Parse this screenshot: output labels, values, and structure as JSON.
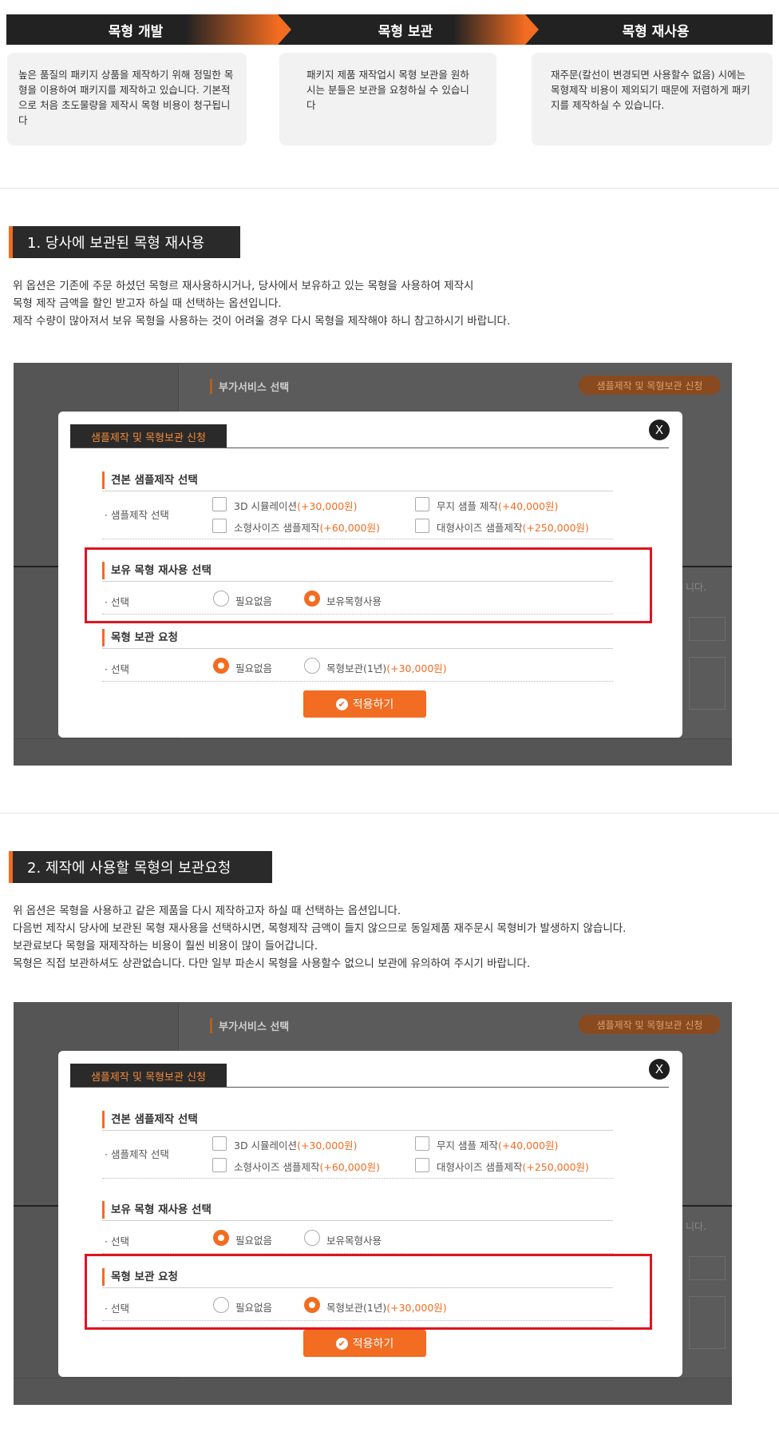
{
  "steps": [
    {
      "label": "목형 개발"
    },
    {
      "label": "목형 보관"
    },
    {
      "label": "목형 재사용"
    }
  ],
  "step_descs": [
    "높은 품질의 패키지 상품을 제작하기 위해 정밀한 목형을 이용하여 패키지를 제작하고 있습니다. 기본적으로 처음 초도물량을 제작시 목형 비용이 청구됩니다",
    "패키지 제품 재작업시 목형 보관을 원하시는 분들은 보관을 요청하실 수 있습니다",
    "재주문(칼선이 변경되면 사용할수 없음) 시에는 목형제작 비용이 제외되기 때문에 저렴하게 패키지를 제작하실 수 있습니다."
  ],
  "section1": {
    "title": "1. 당사에 보관된 목형 재사용",
    "lines": [
      "위 옵션은 기존에 주문 하셨던 목형르 재사용하시거나, 당사에서 보유하고 있는 목형을 사용하여 제작시",
      "목형 제작 금액을 할인 받고자 하실 때 선택하는 옵션입니다.",
      "제작 수량이 많아져서 보유 목형을 사용하는 것이 어려울 경우 다시 목형을 제작해야 하니 참고하시기 바랍니다."
    ]
  },
  "section2": {
    "title": "2. 제작에 사용할 목형의 보관요청",
    "lines": [
      "위 옵션은 목형을 사용하고 같은 제품을 다시 제작하고자 하실 때 선택하는 옵션입니다.",
      "다음번 제작시 당사에 보관된 목형 재사용을 선택하시면, 목형제작 금액이 들지 않으므로 동일제품 재주문시 목형비가 발생하지 않습니다.",
      "보관료보다 목형을 재제작하는 비용이 훨씬 비용이 많이 들어갑니다.",
      "목형은 직접 보관하셔도 상관없습니다. 다만 일부 파손시 목형을 사용할수 없으니 보관에 유의하여 주시기 바랍니다."
    ]
  },
  "bg": {
    "heading": "부가서비스 선택",
    "button": "샘플제작 및 목형보관 신청",
    "side_text": "니다."
  },
  "modal": {
    "tab": "샘플제작 및 목형보관 신청",
    "close": "X",
    "sample_title": "견본 샘플제작 선택",
    "sample_label": "· 샘플제작 선택",
    "sample_opts": [
      {
        "name": "3D 시뮬레이션",
        "price": "(+30,000원)"
      },
      {
        "name": "무지 샘플 제작",
        "price": "(+40,000원)"
      },
      {
        "name": "소형사이즈 샘플제작",
        "price": "(+60,000원)"
      },
      {
        "name": "대형사이즈 샘플제작",
        "price": "(+250,000원)"
      }
    ],
    "reuse_title": "보유 목형 재사용 선택",
    "select_label": "· 선택",
    "reuse_opts": [
      "필요없음",
      "보유목형사용"
    ],
    "storage_title": "목형 보관 요청",
    "storage_opts": [
      {
        "name": "필요없음",
        "price": ""
      },
      {
        "name": "목형보관(1년)",
        "price": "(+30,000원)"
      }
    ],
    "apply": "적용하기",
    "apply_icon": "✔"
  },
  "state": {
    "panel1": {
      "reuse": "보유목형사용",
      "storage": "필요없음"
    },
    "panel2": {
      "reuse": "필요없음",
      "storage": "목형보관(1년)"
    }
  },
  "colors": {
    "accent": "#f26c21",
    "highlight": "#e0141e",
    "dark": "#222222"
  }
}
